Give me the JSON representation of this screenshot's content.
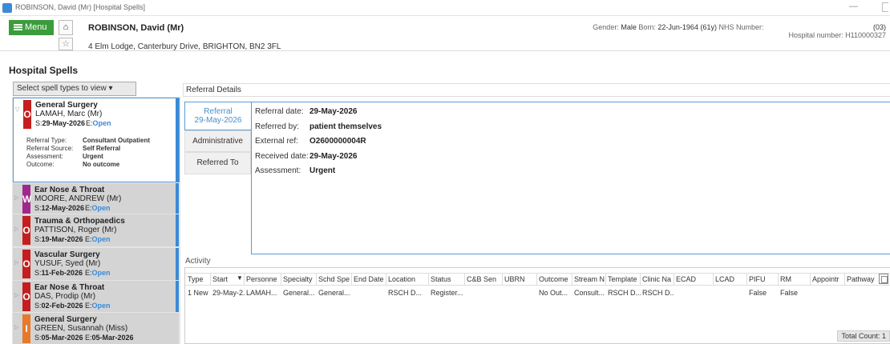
{
  "window": {
    "title": "ROBINSON, David (Mr) [Hospital Spells]",
    "minimize_label": "—"
  },
  "header": {
    "menu_label": "Menu",
    "patient_name": "ROBINSON, David (Mr)",
    "address": "4 Elm Lodge, Canterbury Drive, BRIGHTON, BN2 3FL",
    "gender_label": "Gender:",
    "gender": "Male",
    "born_label": "Born:",
    "born": "22-Jun-1964 (61y)",
    "nhs_label": "NHS Number:",
    "nhs_value": "(03)",
    "hospital_number_label": "Hospital number:",
    "hospital_number": "H110000327"
  },
  "page": {
    "title": "Hospital Spells",
    "filter_label": "Select spell types to view"
  },
  "spells": [
    {
      "specialty": "General Surgery",
      "consultant": "LAMAH, Marc (Mr)",
      "type_letter": "O",
      "color": "#c41e1e",
      "start_label": "S:",
      "start": "29-May-2026",
      "end_label": "E:",
      "end": "Open",
      "details": [
        {
          "k": "Referral Type:",
          "v": "Consultant Outpatient"
        },
        {
          "k": "Referral Source:",
          "v": "Self Referral"
        },
        {
          "k": "Assessment:",
          "v": "Urgent"
        },
        {
          "k": "Outcome:",
          "v": "No outcome"
        }
      ]
    },
    {
      "specialty": "Ear Nose & Throat",
      "consultant": "MOORE, ANDREW (Mr)",
      "type_letter": "W",
      "color": "#a0288a",
      "start_label": "S:",
      "start": "12-May-2026",
      "end_label": "E:",
      "end": "Open"
    },
    {
      "specialty": "Trauma & Orthopaedics",
      "consultant": "PATTISON, Roger (Mr)",
      "type_letter": "O",
      "color": "#c41e1e",
      "start_label": "S:",
      "start": "19-Mar-2026",
      "end_label": "E:",
      "end": "Open"
    },
    {
      "specialty": "Vascular Surgery",
      "consultant": "YUSUF, Syed (Mr)",
      "type_letter": "O",
      "color": "#c41e1e",
      "start_label": "S:",
      "start": "11-Feb-2026",
      "end_label": "E:",
      "end": "Open"
    },
    {
      "specialty": "Ear Nose & Throat",
      "consultant": "DAS, Prodip (Mr)",
      "type_letter": "O",
      "color": "#c41e1e",
      "start_label": "S:",
      "start": "02-Feb-2026",
      "end_label": "E:",
      "end": "Open"
    },
    {
      "specialty": "General Surgery",
      "consultant": "GREEN, Susannah (Miss)",
      "type_letter": "I",
      "color": "#e6792a",
      "start_label": "S:",
      "start": "05-Mar-2026",
      "end_label": "E:",
      "end": "05-Mar-2026"
    }
  ],
  "referral": {
    "section_title": "Referral Details",
    "tabs": [
      {
        "label": "Referral",
        "sub": "29-May-2026"
      },
      {
        "label": "Administrative"
      },
      {
        "label": "Referred To"
      }
    ],
    "fields": [
      {
        "k": "Referral date:",
        "v": "29-May-2026"
      },
      {
        "k": "Referred by:",
        "v": "patient themselves"
      },
      {
        "k": "External ref:",
        "v": "O2600000004R"
      },
      {
        "k": "Received date:",
        "v": "29-May-2026"
      },
      {
        "k": "Assessment:",
        "v": "Urgent"
      }
    ]
  },
  "activity": {
    "title": "Activity",
    "columns": [
      "Type",
      "Start",
      "Personne",
      "Specialty",
      "Schd Spe",
      "End Date",
      "Location",
      "Status",
      "C&B Sen",
      "UBRN",
      "Outcome",
      "Stream N",
      "Template",
      "Clinic Na",
      "ECAD",
      "LCAD",
      "PIFU",
      "RM",
      "Appointr",
      "Pathway"
    ],
    "sort_indicator": "▼",
    "rows": [
      [
        "1 New F...",
        "29-May-2...",
        "LAMAH...",
        "General...",
        "General...",
        "",
        "RSCH D...",
        "Register...",
        "",
        "",
        "No Out...",
        "Consult...",
        "RSCH D...",
        "RSCH D...",
        "",
        "",
        "False",
        "False",
        "",
        ""
      ]
    ],
    "total_count": "Total Count: 1"
  }
}
